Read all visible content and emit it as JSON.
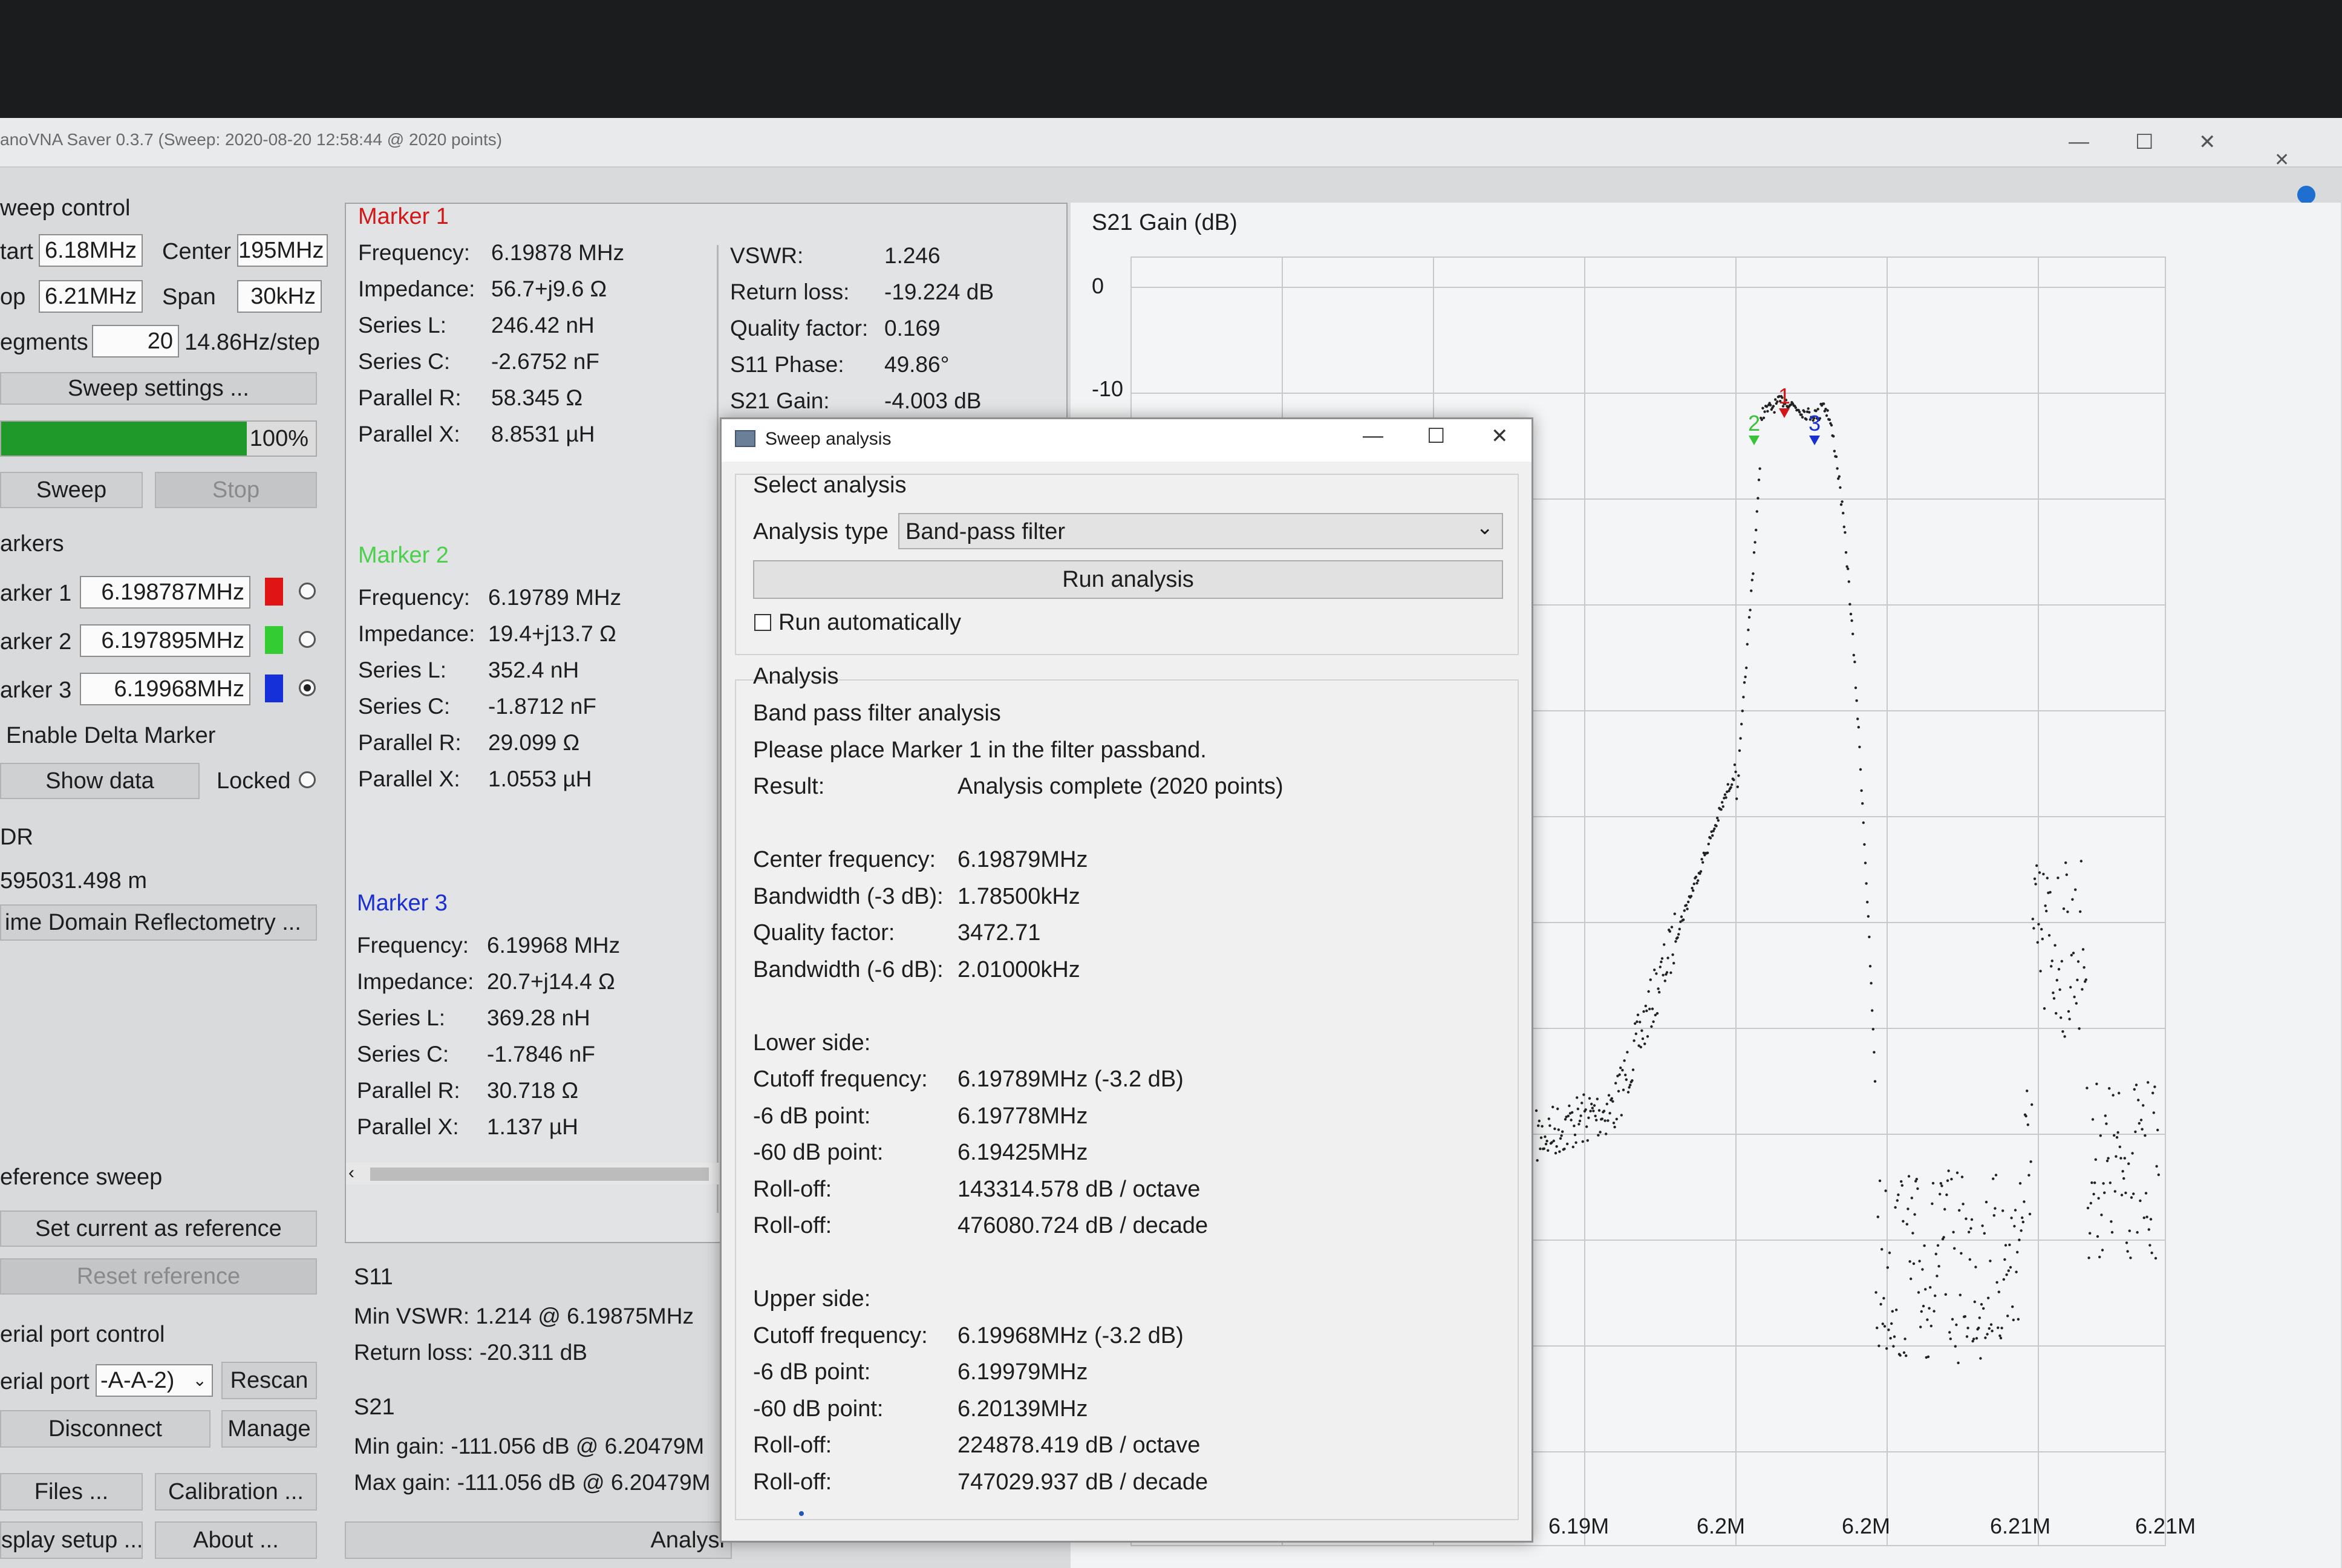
{
  "window": {
    "title": "anoVNA Saver 0.3.7 (Sweep: 2020-08-20 12:58:44 @ 2020 points)",
    "min_glyph": "—",
    "max_glyph": "☐",
    "close_glyph": "✕"
  },
  "sweep_control": {
    "heading": "weep control",
    "start_label": "tart",
    "start_value": "6.18MHz",
    "stop_label": "op",
    "stop_value": "6.21MHz",
    "center_label": "Center",
    "center_value": "195MHz",
    "span_label": "Span",
    "span_value": "30kHz",
    "segments_label": "egments",
    "segments_value": "20",
    "step_text": "14.86Hz/step",
    "settings_button": "Sweep settings ...",
    "progress_text": "100%",
    "progress_percent": 100,
    "sweep_button": "Sweep",
    "stop_button": "Stop"
  },
  "markers": {
    "heading": "arkers",
    "items": [
      {
        "label": "arker 1",
        "value": "6.198787MHz",
        "color": "#e01414",
        "selected": false
      },
      {
        "label": "arker 2",
        "value": "6.197895MHz",
        "color": "#33cc33",
        "selected": false
      },
      {
        "label": "arker 3",
        "value": "6.19968MHz",
        "color": "#1530d8",
        "selected": true
      }
    ],
    "delta_label": "Enable Delta Marker",
    "show_data_button": "Show data",
    "locked_label": "Locked"
  },
  "tdr": {
    "heading": "DR",
    "value": "595031.498 m",
    "button": "ime Domain Reflectometry ..."
  },
  "reference_sweep": {
    "heading": "eference sweep",
    "set_button": "Set current as reference",
    "reset_button": "Reset reference"
  },
  "serial": {
    "heading": "erial port control",
    "port_label": "erial port",
    "port_value": "-A-A-2)",
    "rescan_button": "Rescan",
    "disconnect_button": "Disconnect",
    "manage_button": "Manage"
  },
  "bottom_buttons": {
    "files": "Files ...",
    "calibration": "Calibration ...",
    "display": "splay setup ...",
    "about": "About ...",
    "analysis": "Analysi"
  },
  "marker_panel": {
    "marker1": {
      "title": "Marker 1",
      "title_color": "#d01818",
      "rows": [
        {
          "k": "Frequency:",
          "v": "6.19878 MHz"
        },
        {
          "k": "Impedance:",
          "v": "56.7+j9.6 Ω"
        },
        {
          "k": "Series L:",
          "v": "246.42 nH"
        },
        {
          "k": "Series C:",
          "v": "-2.6752 nF"
        },
        {
          "k": "Parallel R:",
          "v": "58.345 Ω"
        },
        {
          "k": "Parallel X:",
          "v": "8.8531 µH"
        }
      ],
      "rows_right": [
        {
          "k": "VSWR:",
          "v": "1.246"
        },
        {
          "k": "Return loss:",
          "v": "-19.224 dB"
        },
        {
          "k": "Quality factor:",
          "v": "0.169"
        },
        {
          "k": "S11 Phase:",
          "v": "49.86°"
        },
        {
          "k": "S21 Gain:",
          "v": "-4.003 dB"
        }
      ]
    },
    "marker2": {
      "title": "Marker 2",
      "title_color": "#4ccf4c",
      "rows": [
        {
          "k": "Frequency:",
          "v": "6.19789 MHz"
        },
        {
          "k": "Impedance:",
          "v": "19.4+j13.7 Ω"
        },
        {
          "k": "Series L:",
          "v": "352.4 nH"
        },
        {
          "k": "Series C:",
          "v": "-1.8712 nF"
        },
        {
          "k": "Parallel R:",
          "v": "29.099 Ω"
        },
        {
          "k": "Parallel X:",
          "v": "1.0553 µH"
        }
      ]
    },
    "marker3": {
      "title": "Marker 3",
      "title_color": "#1a2fd0",
      "rows": [
        {
          "k": "Frequency:",
          "v": "6.19968 MHz"
        },
        {
          "k": "Impedance:",
          "v": "20.7+j14.4 Ω"
        },
        {
          "k": "Series L:",
          "v": "369.28 nH"
        },
        {
          "k": "Series C:",
          "v": "-1.7846 nF"
        },
        {
          "k": "Parallel R:",
          "v": "30.718 Ω"
        },
        {
          "k": "Parallel X:",
          "v": "1.137 µH"
        }
      ]
    },
    "s11": {
      "heading": "S11",
      "min_vswr": "Min VSWR:  1.214 @ 6.19875MHz",
      "return_loss": "Return loss:  -20.311 dB"
    },
    "s21": {
      "heading": "S21",
      "min_gain": "Min gain:  -111.056 dB @ 6.20479M",
      "max_gain": "Max gain:  -111.056 dB @ 6.20479M"
    }
  },
  "chart_data": {
    "type": "scatter",
    "title": "S21 Gain (dB)",
    "y_tick_labels": [
      "0",
      "-10"
    ],
    "x_tick_labels": [
      "6.19M",
      "6.2M",
      "6.2M",
      "6.21M",
      "6.21M"
    ],
    "markers": [
      {
        "label": "1",
        "color": "#d01818",
        "x": 6.19879
      },
      {
        "label": "2",
        "color": "#3ac23a",
        "x": 6.19789
      },
      {
        "label": "3",
        "color": "#1a2fd0",
        "x": 6.19968
      }
    ]
  },
  "dialog": {
    "title": "Sweep analysis",
    "select_heading": "Select analysis",
    "analysis_type_label": "Analysis type",
    "analysis_type_value": "Band-pass filter",
    "run_button": "Run analysis",
    "auto_label": "Run automatically",
    "analysis_heading": "Analysis",
    "lines": [
      {
        "k": "Band pass filter analysis",
        "v": ""
      },
      {
        "k": "Please place Marker 1 in the filter passband.",
        "v": ""
      },
      {
        "k": "Result:",
        "v": "Analysis complete (2020 points)"
      },
      {
        "k": "",
        "v": ""
      },
      {
        "k": "Center frequency:",
        "v": "6.19879MHz"
      },
      {
        "k": "Bandwidth (-3 dB):",
        "v": "1.78500kHz"
      },
      {
        "k": "Quality factor:",
        "v": "3472.71"
      },
      {
        "k": "Bandwidth (-6 dB):",
        "v": "2.01000kHz"
      },
      {
        "k": "",
        "v": ""
      },
      {
        "k": "Lower side:",
        "v": ""
      },
      {
        "k": "Cutoff frequency:",
        "v": "6.19789MHz (-3.2 dB)"
      },
      {
        "k": "-6 dB point:",
        "v": "6.19778MHz"
      },
      {
        "k": "-60 dB point:",
        "v": "6.19425MHz"
      },
      {
        "k": "Roll-off:",
        "v": "143314.578 dB / octave"
      },
      {
        "k": "Roll-off:",
        "v": "476080.724 dB / decade"
      },
      {
        "k": "",
        "v": ""
      },
      {
        "k": "Upper side:",
        "v": ""
      },
      {
        "k": "Cutoff frequency:",
        "v": "6.19968MHz (-3.2 dB)"
      },
      {
        "k": "-6 dB point:",
        "v": "6.19979MHz"
      },
      {
        "k": "-60 dB point:",
        "v": "6.20139MHz"
      },
      {
        "k": "Roll-off:",
        "v": "224878.419 dB / octave"
      },
      {
        "k": "Roll-off:",
        "v": "747029.937 dB / decade"
      }
    ]
  }
}
